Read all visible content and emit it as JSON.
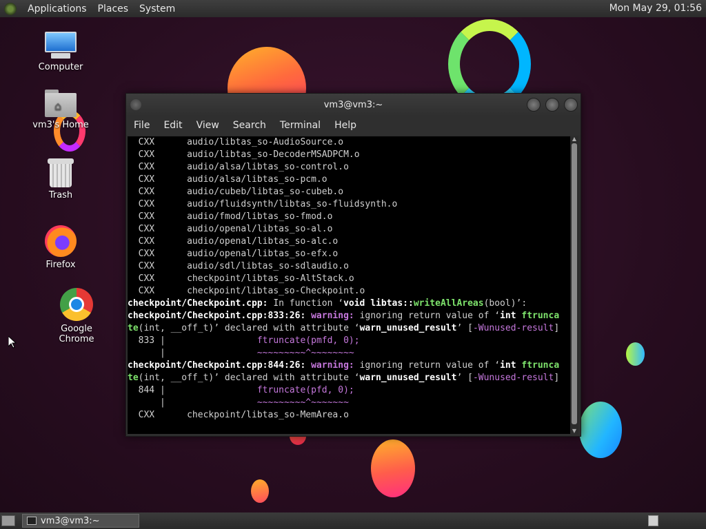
{
  "top_panel": {
    "menus": [
      "Applications",
      "Places",
      "System"
    ],
    "clock": "Mon May 29, 01:56"
  },
  "desktop_icons": [
    {
      "label": "Computer",
      "icon": "computer-icon"
    },
    {
      "label": "vm3's Home",
      "icon": "home-folder-icon"
    },
    {
      "label": "Trash",
      "icon": "trash-icon"
    },
    {
      "label": "Firefox",
      "icon": "firefox-icon"
    },
    {
      "label": "Google Chrome",
      "icon": "chrome-icon"
    }
  ],
  "terminal": {
    "title": "vm3@vm3:~",
    "menus": [
      "File",
      "Edit",
      "View",
      "Search",
      "Terminal",
      "Help"
    ],
    "lines": [
      "  CXX      audio/libtas_so-AudioSource.o",
      "  CXX      audio/libtas_so-DecoderMSADPCM.o",
      "  CXX      audio/alsa/libtas_so-control.o",
      "  CXX      audio/alsa/libtas_so-pcm.o",
      "  CXX      audio/cubeb/libtas_so-cubeb.o",
      "  CXX      audio/fluidsynth/libtas_so-fluidsynth.o",
      "  CXX      audio/fmod/libtas_so-fmod.o",
      "  CXX      audio/openal/libtas_so-al.o",
      "  CXX      audio/openal/libtas_so-alc.o",
      "  CXX      audio/openal/libtas_so-efx.o",
      "  CXX      audio/sdl/libtas_so-sdlaudio.o",
      "  CXX      checkpoint/libtas_so-AltStack.o",
      "  CXX      checkpoint/libtas_so-Checkpoint.o"
    ],
    "diag1": {
      "file": "checkpoint/Checkpoint.cpp:",
      "in_function": " In function ‘",
      "func_sig_a": "void libtas::",
      "func_name": "writeAllAreas",
      "func_sig_b": "(bool)",
      "close": "’:"
    },
    "warn1": {
      "loc": "checkpoint/Checkpoint.cpp:833:26:",
      "kw": " warning:",
      "msg": " ignoring return value of ‘",
      "t1": "int ",
      "fn1": "ftrunca",
      "fn2": "te",
      "args": "(int, __off_t)’ declared with attribute ‘",
      "attr": "warn_unused_result",
      "attr_close": "’ [",
      "flag": "-Wunused-result",
      "flag_close": "]",
      "lineno": "  833 |",
      "code": "                 ftruncate(pmfd, 0);",
      "bar": "      |",
      "caret": "                 ~~~~~~~~~^~~~~~~~~"
    },
    "warn2": {
      "loc": "checkpoint/Checkpoint.cpp:844:26:",
      "kw": " warning:",
      "msg": " ignoring return value of ‘",
      "t1": "int ",
      "fn1": "ftrunca",
      "fn2": "te",
      "args": "(int, __off_t)’ declared with attribute ‘",
      "attr": "warn_unused_result",
      "attr_close": "’ [",
      "flag": "-Wunused-result",
      "flag_close": "]",
      "lineno": "  844 |",
      "code": "                 ftruncate(pfd, 0);",
      "bar": "      |",
      "caret": "                 ~~~~~~~~~^~~~~~~~"
    },
    "last_line": "  CXX      checkpoint/libtas_so-MemArea.o"
  },
  "taskbar": {
    "task_label": "vm3@vm3:~"
  }
}
